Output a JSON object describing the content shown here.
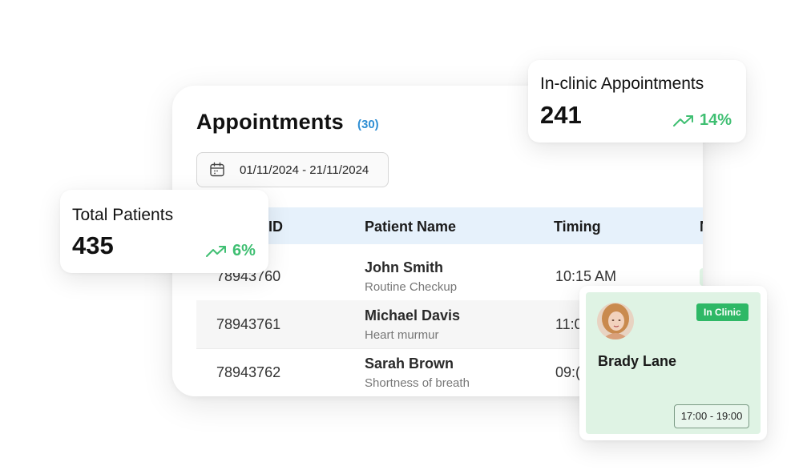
{
  "appointments": {
    "title": "Appointments",
    "count": "(30)",
    "date_range": "01/11/2024 - 21/11/2024",
    "date_icon": "calendar-icon",
    "columns": [
      "ID",
      "Patient Name",
      "Timing",
      "N"
    ],
    "rows": [
      {
        "id": "78943760",
        "name": "John Smith",
        "note": "Routine Checkup",
        "timing": "10:15 AM"
      },
      {
        "id": "78943761",
        "name": "Michael Davis",
        "note": "Heart murmur",
        "timing": "11:0"
      },
      {
        "id": "78943762",
        "name": "Sarah Brown",
        "note": "Shortness of breath",
        "timing": "09:("
      }
    ]
  },
  "total_patients": {
    "label": "Total Patients",
    "value": "435",
    "trend": "6%",
    "trend_icon": "trending-up-icon"
  },
  "in_clinic_appointments": {
    "label": "In-clinic Appointments",
    "value": "241",
    "trend": "14%",
    "trend_icon": "trending-up-icon"
  },
  "patient_card": {
    "status": "In Clinic",
    "name": "Brady Lane",
    "time_slot": "17:00 - 19:00"
  },
  "colors": {
    "accent_blue": "#2f8fd4",
    "trend_green": "#3fbf72",
    "status_green": "#2eb866",
    "card_green": "#dff3e4",
    "table_header": "#e6f1fb"
  }
}
